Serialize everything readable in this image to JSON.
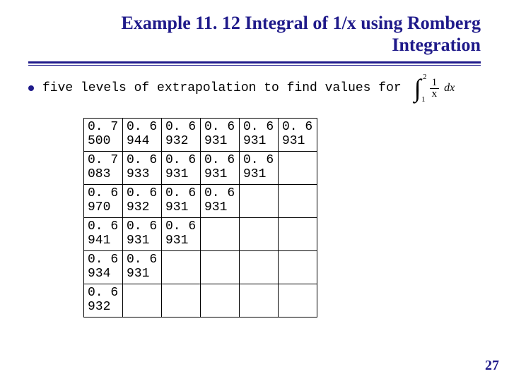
{
  "title": {
    "line1": "Example 11. 12 Integral of 1/x using Romberg",
    "line2": "Integration"
  },
  "bullet_text": "five levels of extrapolation to find values for",
  "integral": {
    "upper": "2",
    "lower": "1",
    "num": "1",
    "den": "x",
    "dx": "dx"
  },
  "chart_data": {
    "type": "table",
    "title": "Romberg integration table",
    "rows": [
      [
        {
          "a": "0. 7",
          "b": "500"
        },
        {
          "a": "0. 6",
          "b": "944"
        },
        {
          "a": "0. 6",
          "b": "932"
        },
        {
          "a": "0. 6",
          "b": "931"
        },
        {
          "a": "0. 6",
          "b": "931"
        },
        {
          "a": "0. 6",
          "b": "931"
        }
      ],
      [
        {
          "a": "0. 7",
          "b": "083"
        },
        {
          "a": "0. 6",
          "b": "933"
        },
        {
          "a": "0. 6",
          "b": "931"
        },
        {
          "a": "0. 6",
          "b": "931"
        },
        {
          "a": "0. 6",
          "b": "931"
        },
        null
      ],
      [
        {
          "a": "0. 6",
          "b": "970"
        },
        {
          "a": "0. 6",
          "b": "932"
        },
        {
          "a": "0. 6",
          "b": "931"
        },
        {
          "a": "0. 6",
          "b": "931"
        },
        null,
        null
      ],
      [
        {
          "a": "0. 6",
          "b": "941"
        },
        {
          "a": "0. 6",
          "b": "931"
        },
        {
          "a": "0. 6",
          "b": "931"
        },
        null,
        null,
        null
      ],
      [
        {
          "a": "0. 6",
          "b": "934"
        },
        {
          "a": "0. 6",
          "b": "931"
        },
        null,
        null,
        null,
        null
      ],
      [
        {
          "a": "0. 6",
          "b": "932"
        },
        null,
        null,
        null,
        null,
        null
      ]
    ]
  },
  "page_number": "27"
}
